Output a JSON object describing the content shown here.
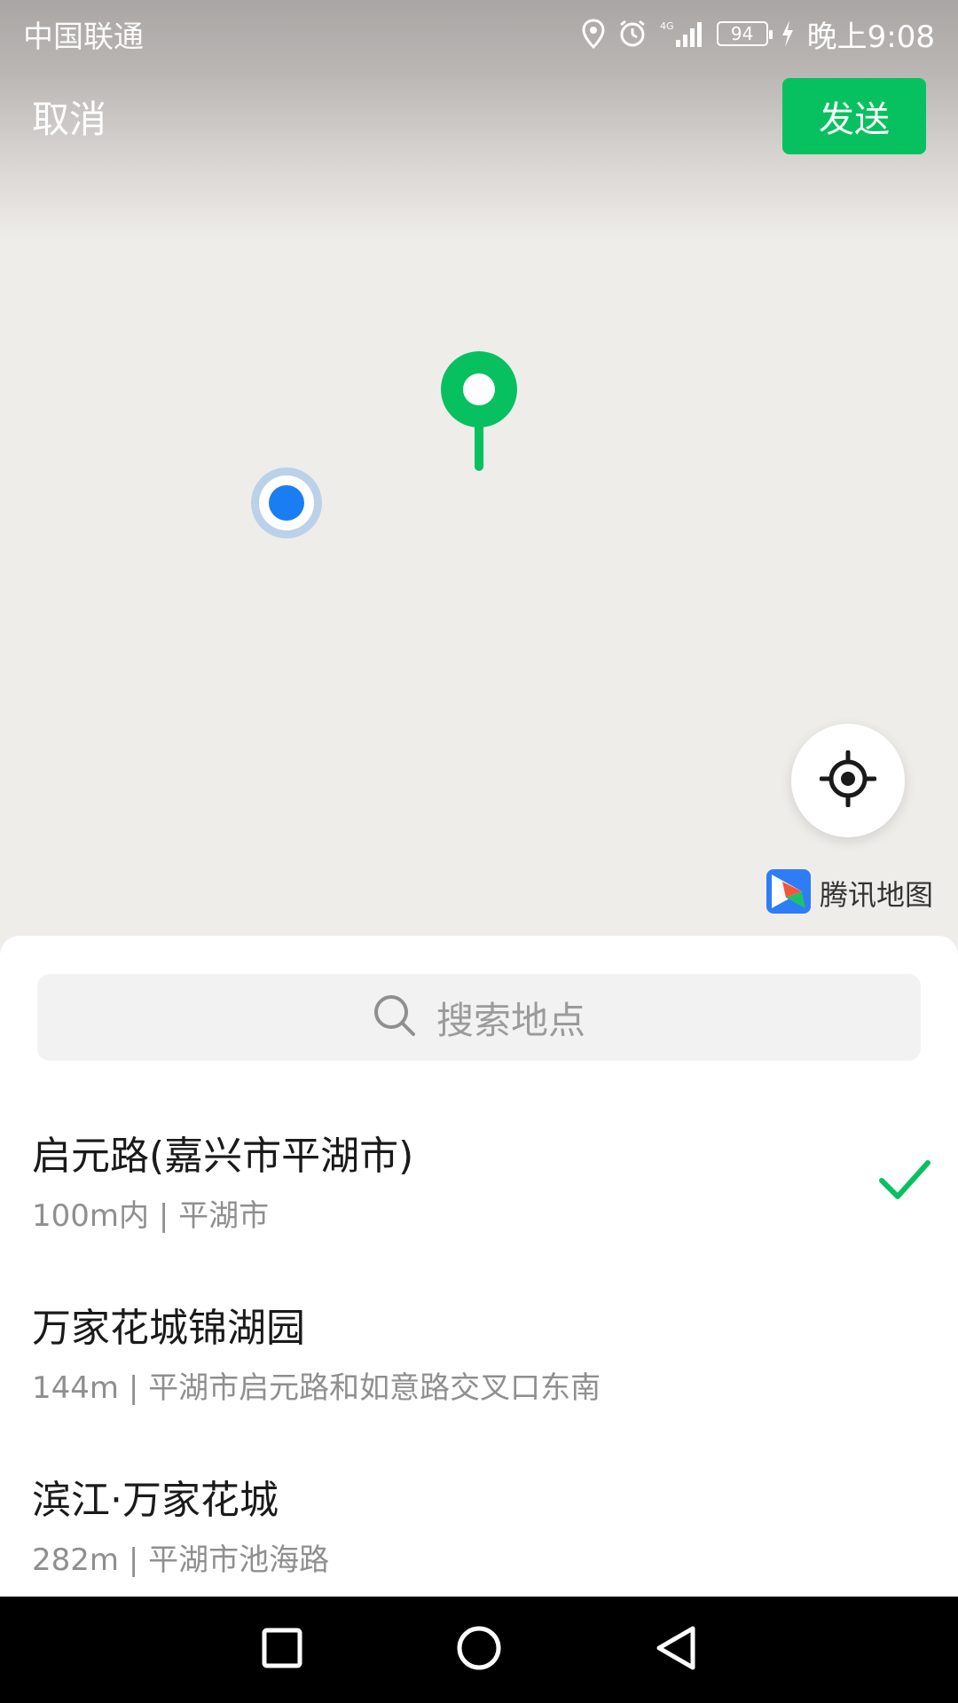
{
  "status_bar": {
    "carrier": "中国联通",
    "network": "4G",
    "battery": "94",
    "time": "晚上9:08"
  },
  "header": {
    "cancel_label": "取消",
    "send_label": "发送",
    "accent_color": "#07c160"
  },
  "map": {
    "logo_text": "腾讯地图",
    "icons": [
      "location-pin-icon",
      "my-location-dot-icon",
      "locate-me-icon",
      "tencent-maps-logo-icon"
    ]
  },
  "search": {
    "placeholder": "搜索地点"
  },
  "places": [
    {
      "name": "启元路(嘉兴市平湖市)",
      "detail": "100m内 | 平湖市",
      "selected": true
    },
    {
      "name": "万家花城锦湖园",
      "detail": "144m | 平湖市启元路和如意路交叉口东南",
      "selected": false
    },
    {
      "name": "滨江·万家花城",
      "detail": "282m | 平湖市池海路",
      "selected": false
    }
  ],
  "nav_bar": {
    "icons": [
      "recents-square-icon",
      "home-circle-icon",
      "back-triangle-icon"
    ]
  }
}
